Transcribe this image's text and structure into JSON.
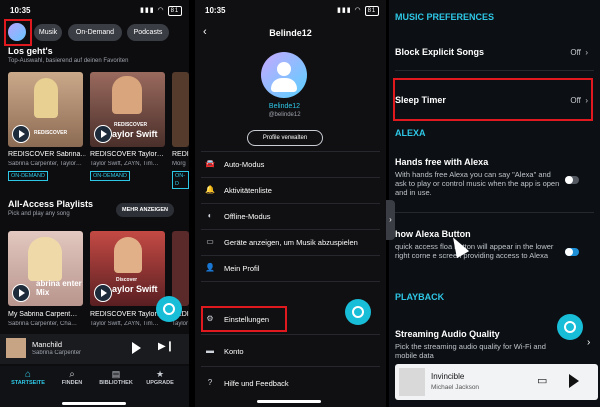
{
  "panel1": {
    "time": "10:35",
    "battery": "81",
    "chips": [
      "Musik",
      "On-Demand",
      "Podcasts"
    ],
    "section1": {
      "title": "Los geht's",
      "subtitle": "Top-Auswahl, basierend auf deinen Favoriten"
    },
    "cards": [
      {
        "label": "REDISCOVER",
        "title": "REDISCOVER Sabrina…",
        "artists": "Sabrina Carpenter, Taylor…",
        "badge": "ON-DEMAND",
        "bg": "#b58e6e"
      },
      {
        "label": "REDISCOVER",
        "banner": "aylor Swift",
        "title": "REDISCOVER Taylor…",
        "artists": "Taylor Swift, ZAYN, Tim…",
        "badge": "ON-DEMAND",
        "bg": "#6a4a40"
      },
      {
        "title": "REDISC",
        "artists": "Morg",
        "badge": "ON-D",
        "bg": "#553b2c"
      }
    ],
    "section2": {
      "title": "All-Access Playlists",
      "subtitle": "Pick and play any song",
      "button": "MEHR ANZEIGEN"
    },
    "playlists": [
      {
        "banner": "abrina enter Mix",
        "title": "My Sabrina Carpent…",
        "artists": "Sabrina Carpenter, Cha…",
        "bg": "#d6b6b0"
      },
      {
        "banner": "aylor Swift",
        "label": "Discover",
        "title": "REDISCOVER Taylor…",
        "artists": "Taylor Swift, ZAYN, Tim…",
        "bg": "#9b3a3a"
      },
      {
        "title": "REDISC",
        "artists": "Taylor",
        "bg": "#5a2a2a"
      }
    ],
    "nowplaying": {
      "title": "Manchild",
      "artist": "Sabrina Carpenter"
    },
    "nav": [
      {
        "label": "STARTSEITE",
        "icon": "home-icon",
        "active": true
      },
      {
        "label": "FINDEN",
        "icon": "search-icon"
      },
      {
        "label": "BIBLIOTHEK",
        "icon": "library-icon"
      },
      {
        "label": "UPGRADE",
        "icon": "star-icon"
      }
    ]
  },
  "panel2": {
    "time": "10:35",
    "battery": "81",
    "header_title": "Belinde12",
    "profile_name": "Belinde12",
    "profile_handle": "@belinde12",
    "manage_button": "Profile verwalten",
    "menu": [
      {
        "label": "Auto-Modus",
        "icon": "car-icon"
      },
      {
        "label": "Aktivitätenliste",
        "icon": "bell-icon"
      },
      {
        "label": "Offline-Modus",
        "icon": "toggle-icon"
      },
      {
        "label": "Geräte anzeigen, um Musik abzuspielen",
        "icon": "cast-icon"
      },
      {
        "label": "Mein Profil",
        "icon": "person-icon"
      },
      {
        "label": "Einstellungen",
        "icon": "gear-icon"
      },
      {
        "label": "Konto",
        "icon": "card-icon"
      },
      {
        "label": "Hilfe und Feedback",
        "icon": "help-icon"
      }
    ]
  },
  "panel3": {
    "sections": {
      "music_preferences": "MUSIC PREFERENCES",
      "alexa": "ALEXA",
      "playback": "PLAYBACK"
    },
    "block_explicit": {
      "label": "Block Explicit Songs",
      "value": "Off"
    },
    "sleep_timer": {
      "label": "Sleep Timer",
      "value": "Off"
    },
    "hands_free": {
      "label": "Hands free with Alexa",
      "desc": "With hands free Alexa you can say \"Alexa\" and ask to play or control music when the app is open and in use."
    },
    "show_button": {
      "label": "how Alexa Button",
      "desc": "quick access floa    button will appear in the lower right corne    e screen providing access to Alexa"
    },
    "streaming": {
      "label": "Streaming Audio Quality",
      "desc": "Pick the streaming audio quality for Wi-Fi and mobile data"
    },
    "nowplaying": {
      "title": "Invincible",
      "artist": "Michael Jackson"
    }
  },
  "colors": {
    "accent": "#2ec7e6",
    "highlight": "#e0191f",
    "alexa": "#18bdd8"
  }
}
